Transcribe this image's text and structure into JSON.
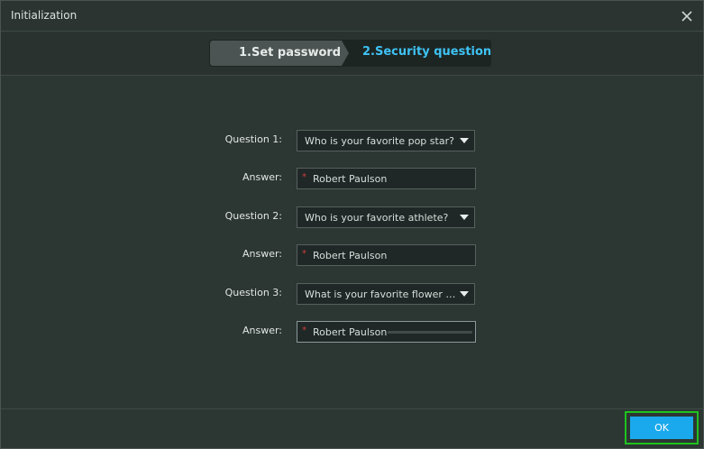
{
  "window": {
    "title": "Initialization"
  },
  "steps": {
    "step1": "1.Set password",
    "step2": "2.Security question",
    "active": 2,
    "active_color": "#3ec3f5"
  },
  "form": {
    "rows": [
      {
        "label": "Question 1:",
        "value": "Who is your favorite pop star?"
      },
      {
        "label": "Answer:",
        "required_mark": "*",
        "value": "Robert Paulson"
      },
      {
        "label": "Question 2:",
        "value": "Who is your favorite athlete?"
      },
      {
        "label": "Answer:",
        "required_mark": "*",
        "value": "Robert Paulson"
      },
      {
        "label": "Question 3:",
        "value": "What is your favorite flower in s..."
      },
      {
        "label": "Answer:",
        "required_mark": "*",
        "value": "Robert Paulson"
      }
    ]
  },
  "footer": {
    "ok_label": "OK",
    "ok_color": "#1aa9ec",
    "highlight_color": "#1fc21f"
  },
  "icons": {
    "close": "close-icon",
    "dropdown": "chevron-down-icon"
  }
}
